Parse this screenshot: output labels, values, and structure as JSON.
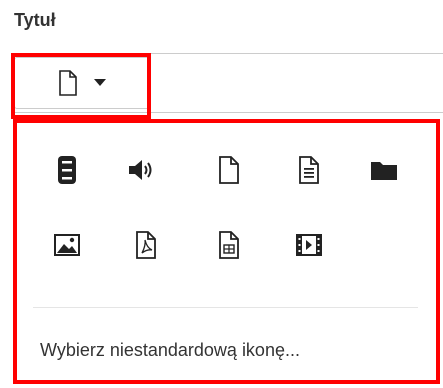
{
  "field": {
    "label": "Tytuł"
  },
  "picker_button": {
    "selected_icon": "file-outline-icon",
    "caret_icon": "caret-down-icon"
  },
  "dropdown": {
    "icons_row1": [
      "database-icon",
      "volume-up-icon",
      "file-outline-icon",
      "file-text-icon",
      "folder-icon"
    ],
    "icons_row2": [
      "image-icon",
      "file-pdf-icon",
      "file-spreadsheet-icon",
      "film-icon"
    ],
    "custom_icon_label": "Wybierz niestandardową ikonę..."
  },
  "colors": {
    "highlight": "#ff0000",
    "icon": "#222222",
    "text": "#333333"
  }
}
